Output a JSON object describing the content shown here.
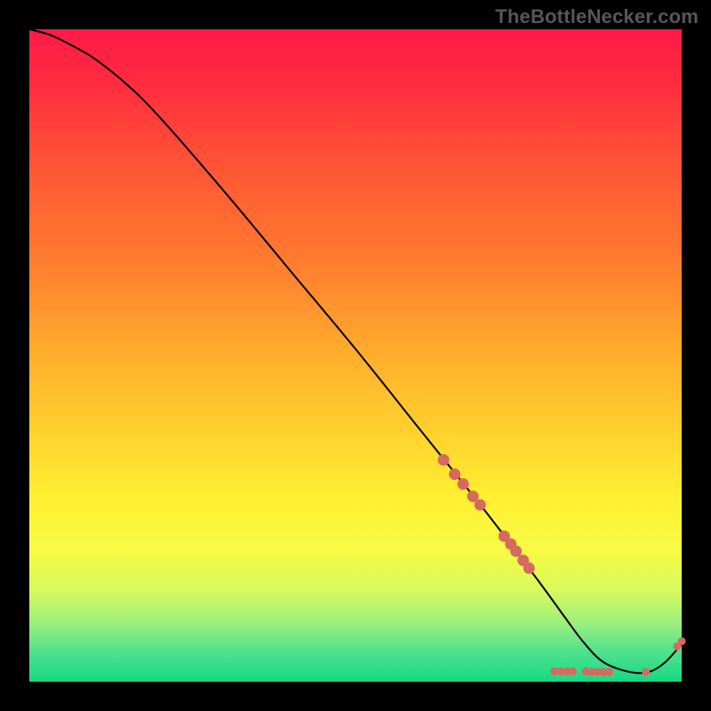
{
  "watermark": "TheBottleNecker.com",
  "chart_data": {
    "type": "line",
    "title": "",
    "xlabel": "",
    "ylabel": "",
    "xlim": [
      0,
      100
    ],
    "ylim": [
      0,
      100
    ],
    "grid": false,
    "legend": false,
    "background_gradient_stops": [
      {
        "offset": 0.0,
        "color": "#ff1a46"
      },
      {
        "offset": 0.08,
        "color": "#ff2b3f"
      },
      {
        "offset": 0.2,
        "color": "#ff5236"
      },
      {
        "offset": 0.35,
        "color": "#ff7a2f"
      },
      {
        "offset": 0.5,
        "color": "#ffae2c"
      },
      {
        "offset": 0.62,
        "color": "#ffd22e"
      },
      {
        "offset": 0.72,
        "color": "#fff032"
      },
      {
        "offset": 0.8,
        "color": "#f7fb43"
      },
      {
        "offset": 0.86,
        "color": "#d7f95e"
      },
      {
        "offset": 0.91,
        "color": "#9bf07d"
      },
      {
        "offset": 0.955,
        "color": "#4fe28e"
      },
      {
        "offset": 1.0,
        "color": "#15d884"
      }
    ],
    "series": [
      {
        "name": "bottleneck-curve",
        "color": "#000000",
        "x": [
          0,
          3,
          6,
          10,
          15,
          20,
          30,
          40,
          50,
          60,
          70,
          78,
          82,
          85,
          88,
          92,
          95,
          97.5,
          100
        ],
        "y": [
          100,
          99.2,
          97.8,
          95.5,
          91.5,
          86.5,
          75.0,
          63.0,
          51.0,
          38.5,
          26.0,
          15.5,
          10.0,
          6.0,
          3.0,
          1.5,
          1.5,
          3.0,
          5.8
        ]
      }
    ],
    "markers": [
      {
        "name": "data-points",
        "color": "#d66a5e",
        "radius_large": 6.5,
        "radius_small": 4.5,
        "points": [
          {
            "x": 63.5,
            "y": 34.0,
            "r": "large"
          },
          {
            "x": 65.2,
            "y": 31.8,
            "r": "large"
          },
          {
            "x": 66.5,
            "y": 30.3,
            "r": "large"
          },
          {
            "x": 68.0,
            "y": 28.4,
            "r": "large"
          },
          {
            "x": 69.1,
            "y": 27.1,
            "r": "large"
          },
          {
            "x": 72.8,
            "y": 22.3,
            "r": "large"
          },
          {
            "x": 73.8,
            "y": 21.1,
            "r": "large"
          },
          {
            "x": 74.6,
            "y": 20.0,
            "r": "large"
          },
          {
            "x": 75.7,
            "y": 18.6,
            "r": "large"
          },
          {
            "x": 76.6,
            "y": 17.4,
            "r": "large"
          },
          {
            "x": 80.5,
            "y": 1.6,
            "r": "small"
          },
          {
            "x": 81.5,
            "y": 1.6,
            "r": "small"
          },
          {
            "x": 82.4,
            "y": 1.6,
            "r": "small"
          },
          {
            "x": 83.3,
            "y": 1.6,
            "r": "small"
          },
          {
            "x": 85.3,
            "y": 1.6,
            "r": "small"
          },
          {
            "x": 86.2,
            "y": 1.5,
            "r": "small"
          },
          {
            "x": 87.1,
            "y": 1.5,
            "r": "small"
          },
          {
            "x": 88.0,
            "y": 1.5,
            "r": "small"
          },
          {
            "x": 88.9,
            "y": 1.5,
            "r": "small"
          },
          {
            "x": 94.5,
            "y": 1.5,
            "r": "small"
          },
          {
            "x": 99.3,
            "y": 5.4,
            "r": "small"
          },
          {
            "x": 100.0,
            "y": 6.2,
            "r": "small"
          }
        ]
      }
    ]
  }
}
